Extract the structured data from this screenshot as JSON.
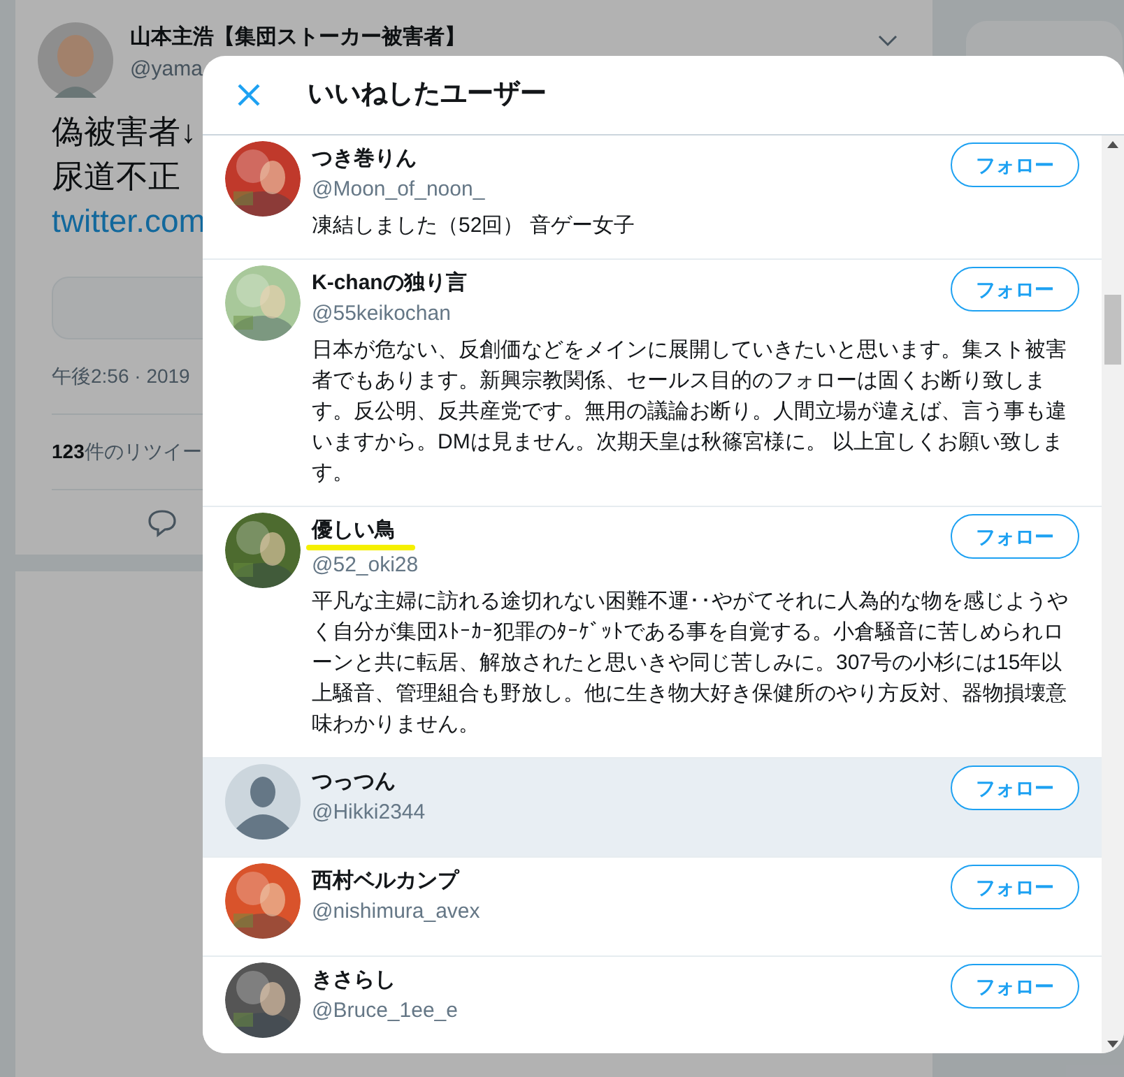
{
  "background": {
    "tweet": {
      "author_name": "山本主浩【集団ストーカー被害者】",
      "author_handle": "@yama",
      "text_lines": [
        "偽被害者↓",
        "尿道不正"
      ],
      "link": "twitter.com",
      "timestamp": "午後2:56 · 2019",
      "retweets_count": "123",
      "retweets_label": "件のリツイー"
    }
  },
  "dialog": {
    "title": "いいねしたユーザー",
    "users": [
      {
        "name": "つき巻りん",
        "handle": "@Moon_of_noon_",
        "bio": "凍結しました（52回） 音ゲー女子",
        "button": "フォロー",
        "highlighted": false,
        "underlined": false
      },
      {
        "name": "K-chanの独り言",
        "handle": "@55keikochan",
        "bio": "日本が危ない、反創価などをメインに展開していきたいと思います。集スト被害者でもあります。新興宗教関係、セールス目的のフォローは固くお断り致します。反公明、反共産党です。無用の議論お断り。人間立場が違えば、言う事も違いますから。DMは見ません。次期天皇は秋篠宮様に。 以上宜しくお願い致します。",
        "button": "フォロー",
        "highlighted": false,
        "underlined": false
      },
      {
        "name": "優しい鳥",
        "handle": "@52_oki28",
        "bio": "平凡な主婦に訪れる途切れない困難不運･･やがてそれに人為的な物を感じようやく自分が集団ｽﾄｰｶｰ犯罪のﾀｰｹﾞｯﾄである事を自覚する。小倉騒音に苦しめられローンと共に転居、解放されたと思いきや同じ苦しみに。307号の小杉には15年以上騒音、管理組合も野放し。他に生き物大好き保健所のやり方反対、器物損壊意味わかりません。",
        "button": "フォロー",
        "highlighted": false,
        "underlined": true
      },
      {
        "name": "つっつん",
        "handle": "@Hikki2344",
        "button": "フォロー",
        "avatar": {
          "kind": "default",
          "color": "#ccd6dd"
        },
        "highlighted": true,
        "underlined": false
      },
      {
        "name": "西村ベルカンプ",
        "handle": "@nishimura_avex",
        "button": "フォロー",
        "highlighted": false,
        "underlined": false
      },
      {
        "name": "きさらし",
        "handle": "@Bruce_1ee_e",
        "button": "フォロー",
        "highlighted": false,
        "underlined": false
      }
    ]
  }
}
